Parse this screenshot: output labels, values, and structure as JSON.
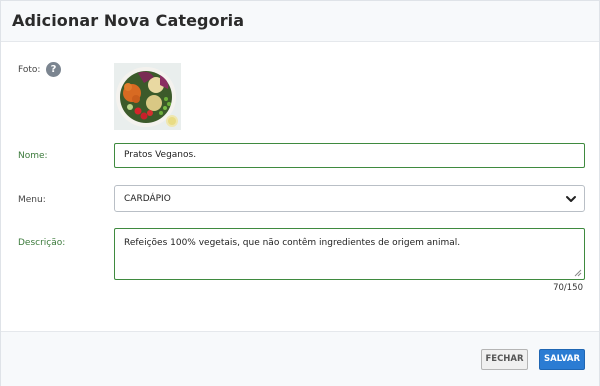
{
  "modal": {
    "title": "Adicionar Nova Categoria"
  },
  "form": {
    "photo_label": "Foto:",
    "help_glyph": "?",
    "name_label": "Nome:",
    "name_value": "Pratos Veganos.",
    "menu_label": "Menu:",
    "menu_selected": "CARDÁPIO",
    "description_label": "Descrição:",
    "description_value": "Refeições 100% vegetais, que não contêm ingredientes de origem animal.",
    "char_counter": "70/150"
  },
  "footer": {
    "close_label": "FECHAR",
    "save_label": "SALVAR"
  },
  "colors": {
    "accent_green": "#3f8a3f",
    "primary_blue": "#2b7cd3"
  }
}
